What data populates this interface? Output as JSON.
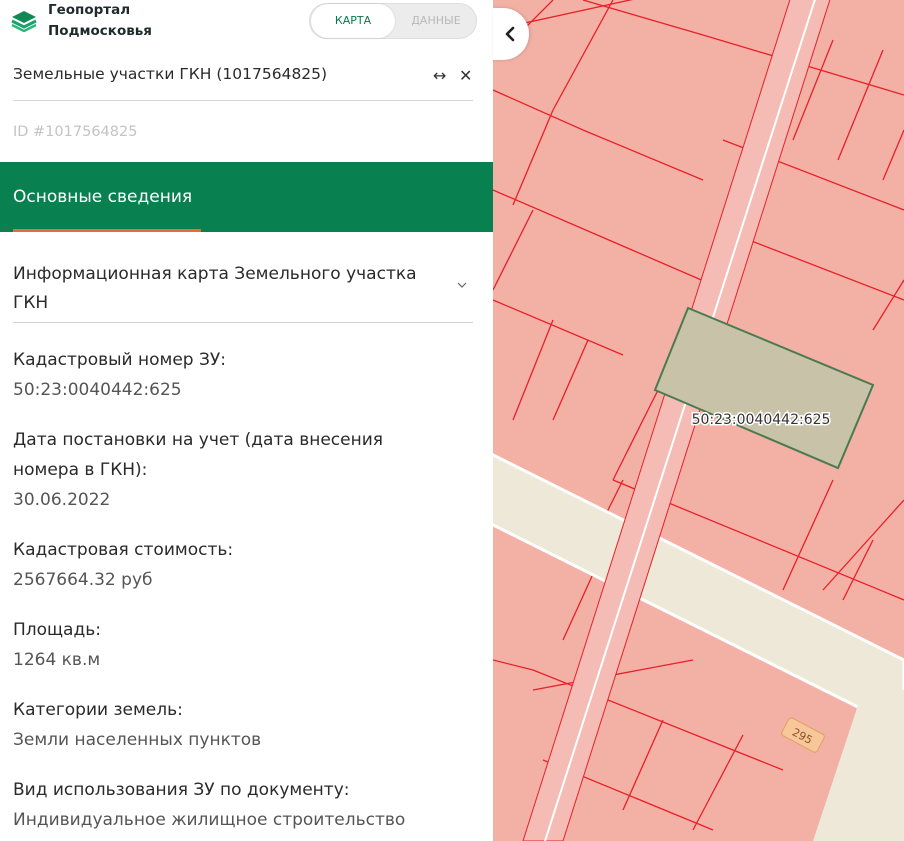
{
  "app": {
    "logo_line1": "Геопортал",
    "logo_line2": "Подмосковья",
    "toggle_map": "КАРТА",
    "toggle_data": "ДАННЫЕ"
  },
  "panel": {
    "title": "Земельные участки ГКН (1017564825)",
    "expand_glyph": "↔",
    "close_glyph": "✕",
    "id_line": "ID #1017564825",
    "section_title": "Основные сведения",
    "accordion_title": "Информационная карта Земельного участка ГКН",
    "fields": [
      {
        "label": "Кадастровый номер ЗУ:",
        "value": "50:23:0040442:625"
      },
      {
        "label": "Дата постановки на учет (дата внесения номера в ГКН):",
        "value": "30.06.2022"
      },
      {
        "label": "Кадастровая стоимость:",
        "value": "2567664.32 руб"
      },
      {
        "label": "Площадь:",
        "value": "1264 кв.м"
      },
      {
        "label": "Категории земель:",
        "value": "Земли населенных пунктов"
      },
      {
        "label": "Вид использования ЗУ по документу:",
        "value": "Индивидуальное жилищное строительство"
      }
    ]
  },
  "map": {
    "parcel_label": "50:23:0040442:625",
    "road_number": "295",
    "collapse_glyph": "‹"
  },
  "colors": {
    "brand_green": "#088050",
    "accent_orange": "#e96a3f",
    "parcel_fill": "#f3b0a4",
    "parcel_border": "#e8202a",
    "selected_parcel": "#c8c3a8",
    "selected_border": "#4a7a50"
  }
}
